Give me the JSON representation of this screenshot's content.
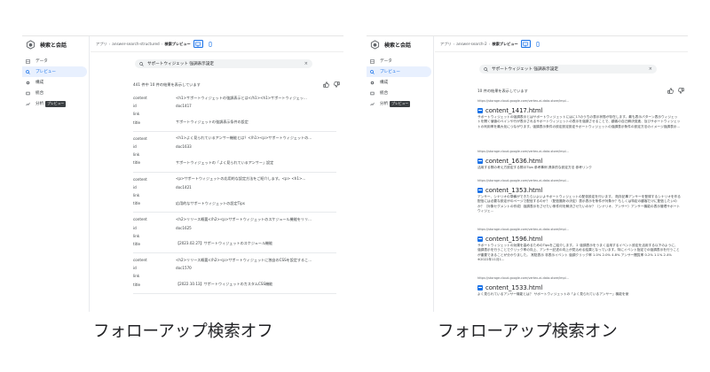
{
  "app": {
    "title": "検索と会話",
    "nav": [
      {
        "label": "データ",
        "icon": "data-table-icon"
      },
      {
        "label": "プレビュー",
        "icon": "search-icon",
        "active": true
      },
      {
        "label": "構成",
        "icon": "gear-icon"
      },
      {
        "label": "統合",
        "icon": "code-icon"
      },
      {
        "label": "分析",
        "icon": "chart-icon",
        "badge": "プレビュー"
      }
    ],
    "accent": "#1a73e8"
  },
  "left": {
    "breadcrumb": [
      "アプリ",
      "answer-search-structured",
      "検索プレビュー"
    ],
    "query": "サポートウィジェット 強調表示設定",
    "count": "441 件中 10 件の結果を表示しています",
    "field_labels": {
      "content": "content",
      "id": "id",
      "link": "link",
      "title": "title"
    },
    "results": [
      {
        "content": "<h1>サポートウィジェットの強調表示とは</h1><h1>サポートウィジェッ...",
        "id": "doc1417",
        "link": "",
        "title": "サポートウィジェットの強調表示条件の設定"
      },
      {
        "content": "<h1>よく見られているアンサー機能とは？</h1><p>サポートウィジェットの...",
        "id": "doc1633",
        "link": "",
        "title": "サポートウィジェットの「よく見られているアンサー」設定"
      },
      {
        "content": "<p>サポートウィジェットの応用的な設定方法をご紹介します。<p> <h1>...",
        "id": "doc1421",
        "link": "",
        "title": "応用的なサポートウィジェットの設定Tips"
      },
      {
        "content": "<h2>リリース概要</h2><p>サポートウィジェットのスケジュール機能をリリ...",
        "id": "doc1625",
        "link": "",
        "title": "【2023.02.27】サポートウィジェットのスケジュール機能"
      },
      {
        "content": "<h2>リリース概要</h2><p>サポートウィジェットに独自のCSSを設定するこ...",
        "id": "doc1570",
        "link": "",
        "title": "【2022.10.13】サポートウィジェットのカスタムCSS機能"
      }
    ]
  },
  "right": {
    "breadcrumb": [
      "アプリ",
      "answer-search-2",
      "検索プレビュー"
    ],
    "query": "サポートウィジェット 強調表示設定",
    "count": "10 件の結果を表示しています",
    "results": [
      {
        "url": "https://storage.cloud.google.com/vertex-ai-data-store/impl...",
        "title": "content_1417.html",
        "body": "サポートウィジェットの強調表示とはサポートウィジェットにはに17のうちの表示状態が存在します。最も表示パターン表示ウィジェットを開く値値のペインや行が表示されるサポートウィジェットの表示を強調させることで、顧客の自己解決促進、及びサポートウィジェットの利用率を最大化につながります。強調表示条件の設定設定設定サポートウィジェットの強調表示条件の設定方法のイメージ強調表示..."
      },
      {
        "url": "https://storage.cloud.google.com/vertex-ai-data-store/impl...",
        "title": "content_1636.html",
        "body": "活用する際の考え方設定する際のTips 参考事例 具体的な設定方法 参考リンク"
      },
      {
        "url": "https://storage.cloud.google.com/vertex-ai-data-store/impl...",
        "title": "content_1353.html",
        "body": "アンサー、シナリオの準備ができたらいよいよサポートウィジェットの配信設定を行います。 既存記事アンサーを登録するシナリオを作る配信には必要な設定がのページで配信するのか？（配信箇所の決定）表示表示を条件が対象か？もしくは特定の顧客だけに配信したいのか？（対象セグメントの作成）強調表示をさせたい条件何を解決させたいのか？（シナリオ、アンサー）アンサー機能の表示管理サポートウィジェ..."
      },
      {
        "url": "https://storage.cloud.google.com/vertex-ai-data-store/impl...",
        "title": "content_1596.html",
        "body": "サポートウィジェットの効果を高めるためのTipsをご紹介します。１ 強調表示をうまく活用するイベント設定を活用する以下のように、強調表示を行うことでクリック率の向上、アンサー記述の向上が見込める結果となっています。特にイベント指定での強調表示を行うことが重要であることが分かりました。 常駐表示 非表示イベント 強調クリック率 1.0% 2.0% 4.8% アンサー閲覧率 0.2% 1.1% 2.4% ※2022年11月1..."
      },
      {
        "url": "https://storage.cloud.google.com/vertex-ai-data-store/impl...",
        "title": "content_1533.html",
        "body": "よく見られているアンサー機能とは？ サポートウィジェットの「よく見られているアンサー」機能を使"
      }
    ]
  },
  "captions": {
    "left": "フォローアップ検索オフ",
    "right": "フォローアップ検索オン"
  }
}
